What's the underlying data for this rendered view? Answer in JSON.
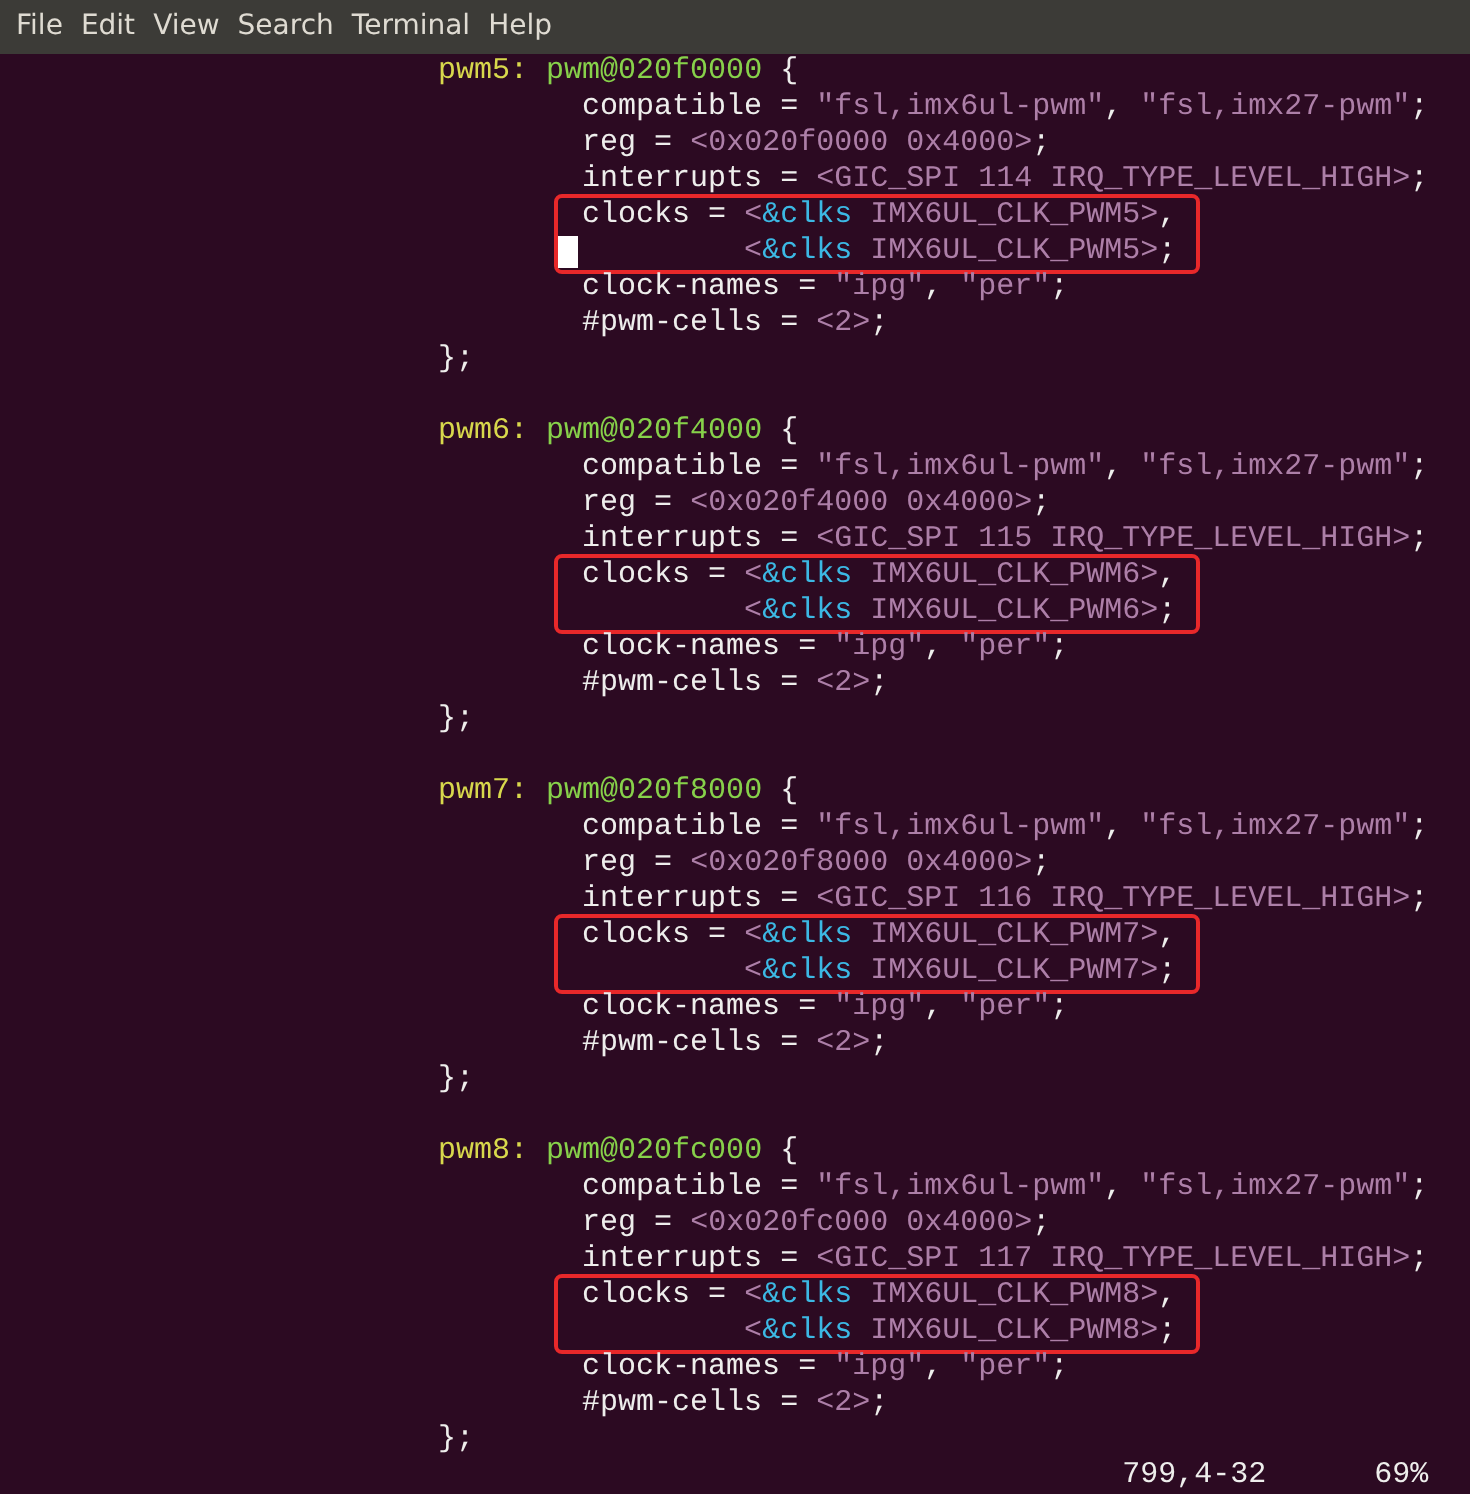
{
  "menu": [
    "File",
    "Edit",
    "View",
    "Search",
    "Terminal",
    "Help"
  ],
  "blocks": [
    {
      "header": [
        {
          "kind": "label",
          "text": "pwm5:"
        },
        {
          "kind": "node",
          "text": "pwm@020f0000"
        },
        {
          "kind": "plain",
          "text": " {"
        }
      ],
      "properties": [
        {
          "highlighted": false,
          "lines": [
            {
              "kind": "property",
              "cursor": false,
              "segments": [
                {
                  "kind": "plain",
                  "text": "compatible = "
                },
                {
                  "kind": "string",
                  "text": "\"fsl,imx6ul-pwm\""
                },
                {
                  "kind": "plain",
                  "text": ", "
                },
                {
                  "kind": "string",
                  "text": "\"fsl,imx27-pwm\""
                },
                {
                  "kind": "plain",
                  "text": ";"
                }
              ]
            }
          ]
        },
        {
          "highlighted": false,
          "lines": [
            {
              "kind": "property",
              "cursor": false,
              "segments": [
                {
                  "kind": "plain",
                  "text": "reg = "
                },
                {
                  "kind": "value",
                  "text": "<0x020f0000 0x4000>"
                },
                {
                  "kind": "plain",
                  "text": ";"
                }
              ]
            }
          ]
        },
        {
          "highlighted": false,
          "lines": [
            {
              "kind": "property",
              "cursor": false,
              "segments": [
                {
                  "kind": "plain",
                  "text": "interrupts = "
                },
                {
                  "kind": "value",
                  "text": "<GIC_SPI 114 IRQ_TYPE_LEVEL_HIGH>"
                },
                {
                  "kind": "plain",
                  "text": ";"
                }
              ]
            }
          ]
        },
        {
          "highlighted": true,
          "lines": [
            {
              "kind": "property",
              "cursor": false,
              "segments": [
                {
                  "kind": "plain",
                  "text": "clocks = "
                },
                {
                  "kind": "value",
                  "text": "<"
                },
                {
                  "kind": "ref",
                  "text": "&clks"
                },
                {
                  "kind": "value",
                  "text": " IMX6UL_CLK_PWM5>"
                },
                {
                  "kind": "plain",
                  "text": ","
                }
              ]
            },
            {
              "kind": "continuation",
              "cursor": true,
              "segments": [
                {
                  "kind": "value",
                  "text": "<"
                },
                {
                  "kind": "ref",
                  "text": "&clks"
                },
                {
                  "kind": "value",
                  "text": " IMX6UL_CLK_PWM5>"
                },
                {
                  "kind": "plain",
                  "text": ";"
                }
              ]
            }
          ]
        },
        {
          "highlighted": false,
          "lines": [
            {
              "kind": "property",
              "cursor": false,
              "segments": [
                {
                  "kind": "plain",
                  "text": "clock-names = "
                },
                {
                  "kind": "string",
                  "text": "\"ipg\""
                },
                {
                  "kind": "plain",
                  "text": ", "
                },
                {
                  "kind": "string",
                  "text": "\"per\""
                },
                {
                  "kind": "plain",
                  "text": ";"
                }
              ]
            }
          ]
        },
        {
          "highlighted": false,
          "lines": [
            {
              "kind": "property",
              "cursor": false,
              "segments": [
                {
                  "kind": "plain",
                  "text": "#pwm-cells = "
                },
                {
                  "kind": "value",
                  "text": "<2>"
                },
                {
                  "kind": "plain",
                  "text": ";"
                }
              ]
            }
          ]
        }
      ],
      "footer": [
        {
          "kind": "plain",
          "text": "};"
        }
      ]
    },
    {
      "header": [
        {
          "kind": "label",
          "text": "pwm6:"
        },
        {
          "kind": "node",
          "text": "pwm@020f4000"
        },
        {
          "kind": "plain",
          "text": " {"
        }
      ],
      "properties": [
        {
          "highlighted": false,
          "lines": [
            {
              "kind": "property",
              "cursor": false,
              "segments": [
                {
                  "kind": "plain",
                  "text": "compatible = "
                },
                {
                  "kind": "string",
                  "text": "\"fsl,imx6ul-pwm\""
                },
                {
                  "kind": "plain",
                  "text": ", "
                },
                {
                  "kind": "string",
                  "text": "\"fsl,imx27-pwm\""
                },
                {
                  "kind": "plain",
                  "text": ";"
                }
              ]
            }
          ]
        },
        {
          "highlighted": false,
          "lines": [
            {
              "kind": "property",
              "cursor": false,
              "segments": [
                {
                  "kind": "plain",
                  "text": "reg = "
                },
                {
                  "kind": "value",
                  "text": "<0x020f4000 0x4000>"
                },
                {
                  "kind": "plain",
                  "text": ";"
                }
              ]
            }
          ]
        },
        {
          "highlighted": false,
          "lines": [
            {
              "kind": "property",
              "cursor": false,
              "segments": [
                {
                  "kind": "plain",
                  "text": "interrupts = "
                },
                {
                  "kind": "value",
                  "text": "<GIC_SPI 115 IRQ_TYPE_LEVEL_HIGH>"
                },
                {
                  "kind": "plain",
                  "text": ";"
                }
              ]
            }
          ]
        },
        {
          "highlighted": true,
          "lines": [
            {
              "kind": "property",
              "cursor": false,
              "segments": [
                {
                  "kind": "plain",
                  "text": "clocks = "
                },
                {
                  "kind": "value",
                  "text": "<"
                },
                {
                  "kind": "ref",
                  "text": "&clks"
                },
                {
                  "kind": "value",
                  "text": " IMX6UL_CLK_PWM6>"
                },
                {
                  "kind": "plain",
                  "text": ","
                }
              ]
            },
            {
              "kind": "continuation",
              "cursor": false,
              "segments": [
                {
                  "kind": "value",
                  "text": "<"
                },
                {
                  "kind": "ref",
                  "text": "&clks"
                },
                {
                  "kind": "value",
                  "text": " IMX6UL_CLK_PWM6>"
                },
                {
                  "kind": "plain",
                  "text": ";"
                }
              ]
            }
          ]
        },
        {
          "highlighted": false,
          "lines": [
            {
              "kind": "property",
              "cursor": false,
              "segments": [
                {
                  "kind": "plain",
                  "text": "clock-names = "
                },
                {
                  "kind": "string",
                  "text": "\"ipg\""
                },
                {
                  "kind": "plain",
                  "text": ", "
                },
                {
                  "kind": "string",
                  "text": "\"per\""
                },
                {
                  "kind": "plain",
                  "text": ";"
                }
              ]
            }
          ]
        },
        {
          "highlighted": false,
          "lines": [
            {
              "kind": "property",
              "cursor": false,
              "segments": [
                {
                  "kind": "plain",
                  "text": "#pwm-cells = "
                },
                {
                  "kind": "value",
                  "text": "<2>"
                },
                {
                  "kind": "plain",
                  "text": ";"
                }
              ]
            }
          ]
        }
      ],
      "footer": [
        {
          "kind": "plain",
          "text": "};"
        }
      ]
    },
    {
      "header": [
        {
          "kind": "label",
          "text": "pwm7:"
        },
        {
          "kind": "node",
          "text": "pwm@020f8000"
        },
        {
          "kind": "plain",
          "text": " {"
        }
      ],
      "properties": [
        {
          "highlighted": false,
          "lines": [
            {
              "kind": "property",
              "cursor": false,
              "segments": [
                {
                  "kind": "plain",
                  "text": "compatible = "
                },
                {
                  "kind": "string",
                  "text": "\"fsl,imx6ul-pwm\""
                },
                {
                  "kind": "plain",
                  "text": ", "
                },
                {
                  "kind": "string",
                  "text": "\"fsl,imx27-pwm\""
                },
                {
                  "kind": "plain",
                  "text": ";"
                }
              ]
            }
          ]
        },
        {
          "highlighted": false,
          "lines": [
            {
              "kind": "property",
              "cursor": false,
              "segments": [
                {
                  "kind": "plain",
                  "text": "reg = "
                },
                {
                  "kind": "value",
                  "text": "<0x020f8000 0x4000>"
                },
                {
                  "kind": "plain",
                  "text": ";"
                }
              ]
            }
          ]
        },
        {
          "highlighted": false,
          "lines": [
            {
              "kind": "property",
              "cursor": false,
              "segments": [
                {
                  "kind": "plain",
                  "text": "interrupts = "
                },
                {
                  "kind": "value",
                  "text": "<GIC_SPI 116 IRQ_TYPE_LEVEL_HIGH>"
                },
                {
                  "kind": "plain",
                  "text": ";"
                }
              ]
            }
          ]
        },
        {
          "highlighted": true,
          "lines": [
            {
              "kind": "property",
              "cursor": false,
              "segments": [
                {
                  "kind": "plain",
                  "text": "clocks = "
                },
                {
                  "kind": "value",
                  "text": "<"
                },
                {
                  "kind": "ref",
                  "text": "&clks"
                },
                {
                  "kind": "value",
                  "text": " IMX6UL_CLK_PWM7>"
                },
                {
                  "kind": "plain",
                  "text": ","
                }
              ]
            },
            {
              "kind": "continuation",
              "cursor": false,
              "segments": [
                {
                  "kind": "value",
                  "text": "<"
                },
                {
                  "kind": "ref",
                  "text": "&clks"
                },
                {
                  "kind": "value",
                  "text": " IMX6UL_CLK_PWM7>"
                },
                {
                  "kind": "plain",
                  "text": ";"
                }
              ]
            }
          ]
        },
        {
          "highlighted": false,
          "lines": [
            {
              "kind": "property",
              "cursor": false,
              "segments": [
                {
                  "kind": "plain",
                  "text": "clock-names = "
                },
                {
                  "kind": "string",
                  "text": "\"ipg\""
                },
                {
                  "kind": "plain",
                  "text": ", "
                },
                {
                  "kind": "string",
                  "text": "\"per\""
                },
                {
                  "kind": "plain",
                  "text": ";"
                }
              ]
            }
          ]
        },
        {
          "highlighted": false,
          "lines": [
            {
              "kind": "property",
              "cursor": false,
              "segments": [
                {
                  "kind": "plain",
                  "text": "#pwm-cells = "
                },
                {
                  "kind": "value",
                  "text": "<2>"
                },
                {
                  "kind": "plain",
                  "text": ";"
                }
              ]
            }
          ]
        }
      ],
      "footer": [
        {
          "kind": "plain",
          "text": "};"
        }
      ]
    },
    {
      "header": [
        {
          "kind": "label",
          "text": "pwm8:"
        },
        {
          "kind": "node",
          "text": "pwm@020fc000"
        },
        {
          "kind": "plain",
          "text": " {"
        }
      ],
      "properties": [
        {
          "highlighted": false,
          "lines": [
            {
              "kind": "property",
              "cursor": false,
              "segments": [
                {
                  "kind": "plain",
                  "text": "compatible = "
                },
                {
                  "kind": "string",
                  "text": "\"fsl,imx6ul-pwm\""
                },
                {
                  "kind": "plain",
                  "text": ", "
                },
                {
                  "kind": "string",
                  "text": "\"fsl,imx27-pwm\""
                },
                {
                  "kind": "plain",
                  "text": ";"
                }
              ]
            }
          ]
        },
        {
          "highlighted": false,
          "lines": [
            {
              "kind": "property",
              "cursor": false,
              "segments": [
                {
                  "kind": "plain",
                  "text": "reg = "
                },
                {
                  "kind": "value",
                  "text": "<0x020fc000 0x4000>"
                },
                {
                  "kind": "plain",
                  "text": ";"
                }
              ]
            }
          ]
        },
        {
          "highlighted": false,
          "lines": [
            {
              "kind": "property",
              "cursor": false,
              "segments": [
                {
                  "kind": "plain",
                  "text": "interrupts = "
                },
                {
                  "kind": "value",
                  "text": "<GIC_SPI 117 IRQ_TYPE_LEVEL_HIGH>"
                },
                {
                  "kind": "plain",
                  "text": ";"
                }
              ]
            }
          ]
        },
        {
          "highlighted": true,
          "lines": [
            {
              "kind": "property",
              "cursor": false,
              "segments": [
                {
                  "kind": "plain",
                  "text": "clocks = "
                },
                {
                  "kind": "value",
                  "text": "<"
                },
                {
                  "kind": "ref",
                  "text": "&clks"
                },
                {
                  "kind": "value",
                  "text": " IMX6UL_CLK_PWM8>"
                },
                {
                  "kind": "plain",
                  "text": ","
                }
              ]
            },
            {
              "kind": "continuation",
              "cursor": false,
              "segments": [
                {
                  "kind": "value",
                  "text": "<"
                },
                {
                  "kind": "ref",
                  "text": "&clks"
                },
                {
                  "kind": "value",
                  "text": " IMX6UL_CLK_PWM8>"
                },
                {
                  "kind": "plain",
                  "text": ";"
                }
              ]
            }
          ]
        },
        {
          "highlighted": false,
          "lines": [
            {
              "kind": "property",
              "cursor": false,
              "segments": [
                {
                  "kind": "plain",
                  "text": "clock-names = "
                },
                {
                  "kind": "string",
                  "text": "\"ipg\""
                },
                {
                  "kind": "plain",
                  "text": ", "
                },
                {
                  "kind": "string",
                  "text": "\"per\""
                },
                {
                  "kind": "plain",
                  "text": ";"
                }
              ]
            }
          ]
        },
        {
          "highlighted": false,
          "lines": [
            {
              "kind": "property",
              "cursor": false,
              "segments": [
                {
                  "kind": "plain",
                  "text": "#pwm-cells = "
                },
                {
                  "kind": "value",
                  "text": "<2>"
                },
                {
                  "kind": "plain",
                  "text": ";"
                }
              ]
            }
          ]
        }
      ],
      "footer": [
        {
          "kind": "plain",
          "text": "};"
        }
      ]
    }
  ],
  "status": {
    "position": "799,4-32",
    "percent": "69%"
  }
}
